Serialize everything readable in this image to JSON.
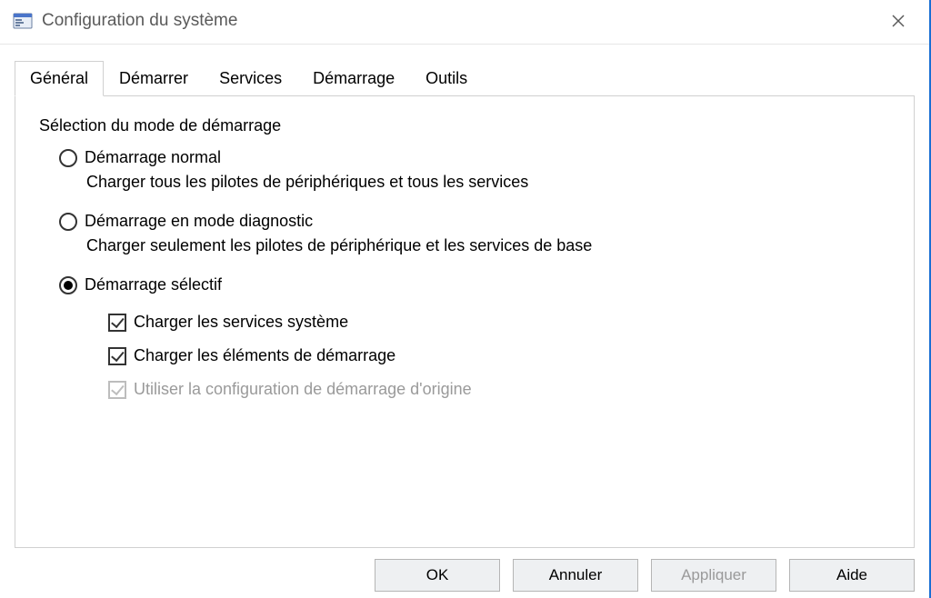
{
  "window": {
    "title": "Configuration du système"
  },
  "tabs": {
    "general": "Général",
    "boot": "Démarrer",
    "services": "Services",
    "startup": "Démarrage",
    "tools": "Outils"
  },
  "group": {
    "title": "Sélection du mode de démarrage",
    "normal": {
      "label": "Démarrage normal",
      "desc": "Charger tous les pilotes de périphériques et tous les services"
    },
    "diagnostic": {
      "label": "Démarrage en mode diagnostic",
      "desc": "Charger seulement les pilotes de périphérique et les services de base"
    },
    "selective": {
      "label": "Démarrage sélectif",
      "load_services": "Charger les services système",
      "load_startup": "Charger les éléments de démarrage",
      "use_original": "Utiliser la configuration de démarrage d'origine"
    }
  },
  "buttons": {
    "ok": "OK",
    "cancel": "Annuler",
    "apply": "Appliquer",
    "help": "Aide"
  }
}
